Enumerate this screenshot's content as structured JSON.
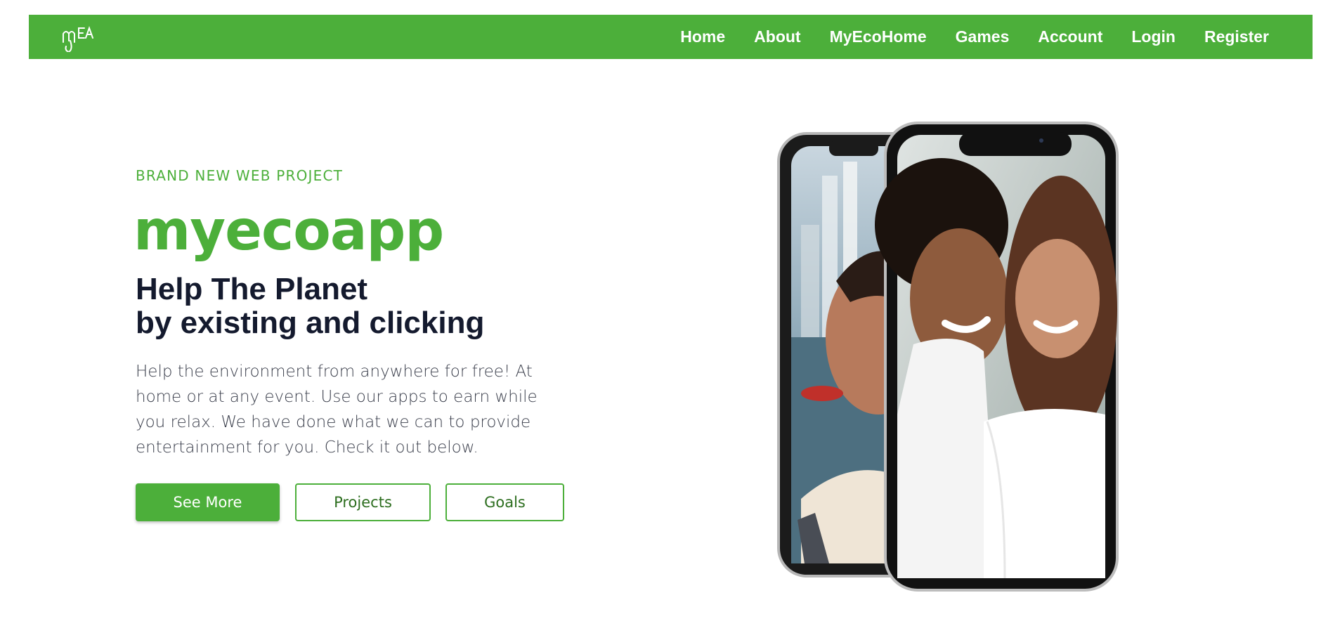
{
  "nav": {
    "logo_text": "MEA",
    "links": [
      "Home",
      "About",
      "MyEcoHome",
      "Games",
      "Account",
      "Login",
      "Register"
    ]
  },
  "hero": {
    "eyebrow": "BRAND NEW WEB PROJECT",
    "brand": "myecoapp",
    "headline_line1": "Help The Planet",
    "headline_line2": "by existing and clicking",
    "description": "Help the environment from anywhere for free! At home or at any event. Use our apps to earn while you relax. We have done what we can to provide entertainment for you. Check it out below.",
    "buttons": {
      "primary": "See More",
      "secondary": "Projects",
      "tertiary": "Goals"
    }
  },
  "colors": {
    "brand_green": "#4caf3a",
    "headline": "#141a2e"
  }
}
